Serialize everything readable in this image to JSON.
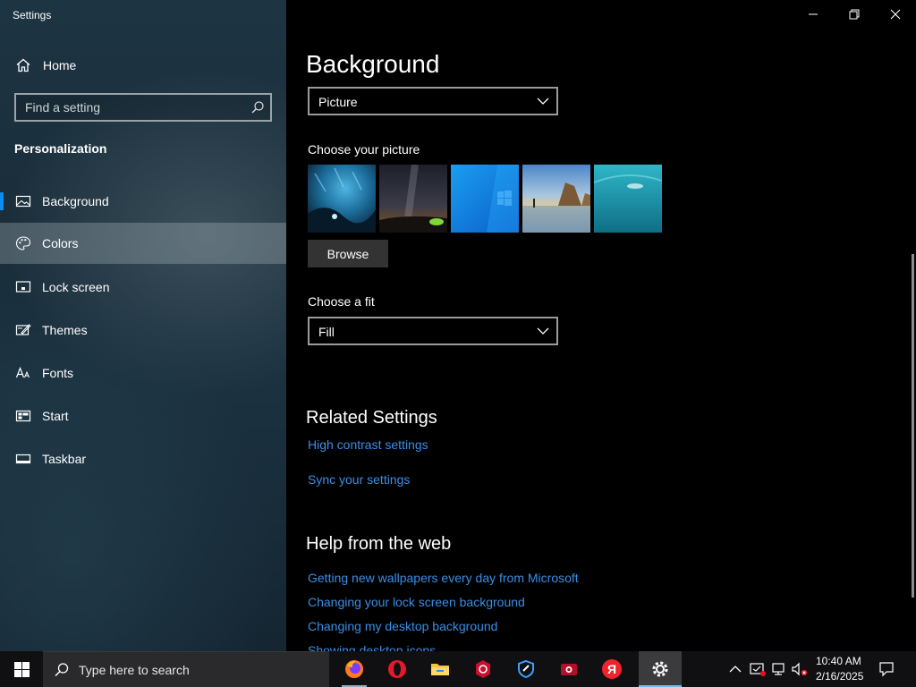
{
  "window": {
    "title": "Settings"
  },
  "sidebar": {
    "home_label": "Home",
    "search_placeholder": "Find a setting",
    "section_title": "Personalization",
    "items": [
      {
        "label": "Background",
        "icon": "image-icon"
      },
      {
        "label": "Colors",
        "icon": "palette-icon"
      },
      {
        "label": "Lock screen",
        "icon": "lock-screen-icon"
      },
      {
        "label": "Themes",
        "icon": "themes-icon"
      },
      {
        "label": "Fonts",
        "icon": "fonts-icon"
      },
      {
        "label": "Start",
        "icon": "start-icon"
      },
      {
        "label": "Taskbar",
        "icon": "taskbar-icon"
      }
    ],
    "selected_item": "Background",
    "hover_item": "Colors"
  },
  "main": {
    "title": "Background",
    "background_type": "Picture",
    "choose_picture_label": "Choose your picture",
    "browse_label": "Browse",
    "choose_fit_label": "Choose a fit",
    "fit_value": "Fill",
    "related_title": "Related Settings",
    "related_links": [
      "High contrast settings",
      "Sync your settings"
    ],
    "help_title": "Help from the web",
    "help_links": [
      "Getting new wallpapers every day from Microsoft",
      "Changing your lock screen background",
      "Changing my desktop background",
      "Showing desktop icons"
    ]
  },
  "taskbar": {
    "search_placeholder": "Type here to search",
    "apps": [
      "firefox-icon",
      "opera-icon",
      "file-explorer-icon",
      "app-red-icon",
      "defender-icon",
      "screen-recorder-icon",
      "yandex-icon",
      "settings-gear-icon"
    ],
    "time": "10:40 AM",
    "date": "2/16/2025"
  },
  "colors": {
    "accent": "#0a8cf0",
    "link": "#3a8ee6",
    "sidebar_bg": "#1b3140",
    "main_bg": "#000000"
  }
}
